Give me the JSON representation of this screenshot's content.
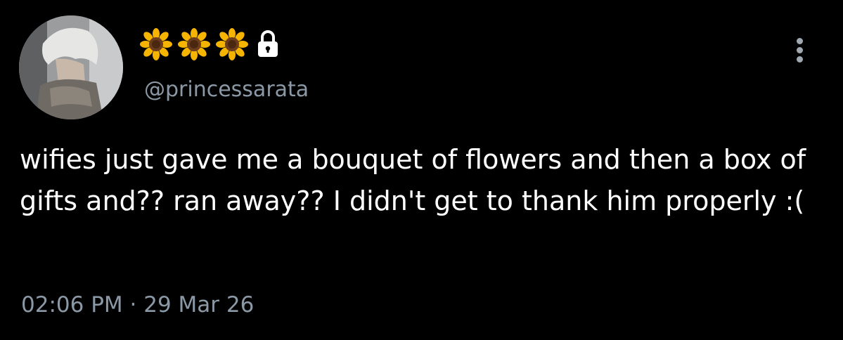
{
  "colors": {
    "background": "#000000",
    "text_primary": "#ffffff",
    "text_secondary": "#8b98a5"
  },
  "header": {
    "avatar_alt": "profile-photo",
    "display_name_icons": [
      "sunflower-icon",
      "sunflower-icon",
      "sunflower-icon",
      "lock-icon"
    ],
    "handle": "@princessarata"
  },
  "tweet": {
    "text": "wifies just gave me a bouquet of flowers and then a box of gifts and?? ran away?? I didn't get to thank him properly :(",
    "time": "02:06 PM",
    "separator": "·",
    "date": "29 Mar 26"
  }
}
